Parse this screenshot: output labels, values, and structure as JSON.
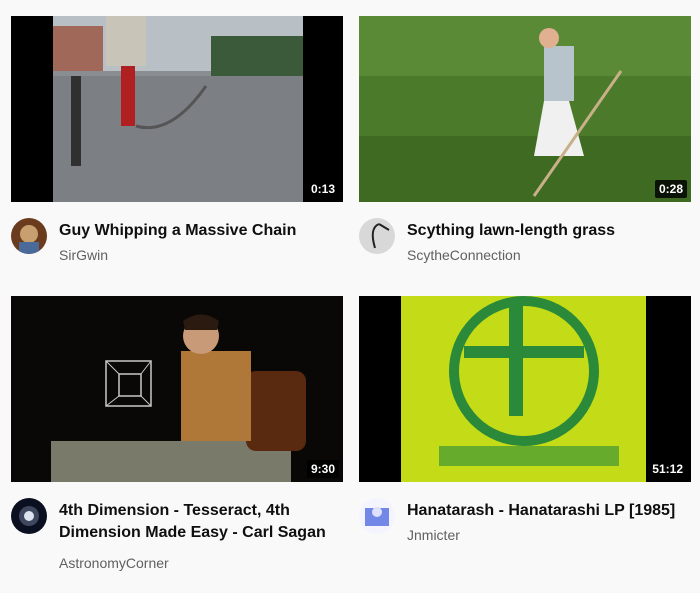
{
  "videos": [
    {
      "title": "Guy Whipping a Massive Chain",
      "channel": "SirGwin",
      "duration": "0:13"
    },
    {
      "title": "Scything lawn-length grass",
      "channel": "ScytheConnection",
      "duration": "0:28"
    },
    {
      "title": "4th Dimension - Tesseract, 4th Dimension Made Easy - Carl Sagan",
      "channel": "AstronomyCorner",
      "duration": "9:30"
    },
    {
      "title": "Hanatarash - Hanatarashi LP [1985]",
      "channel": "Jnmicter",
      "duration": "51:12"
    }
  ]
}
